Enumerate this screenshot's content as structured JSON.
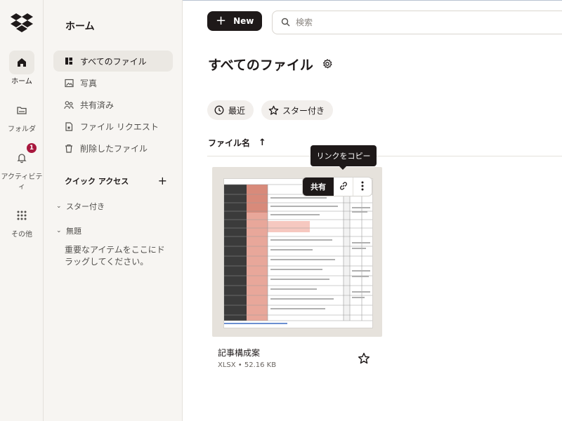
{
  "rail": {
    "items": [
      {
        "label": "ホーム",
        "icon": "home-icon"
      },
      {
        "label": "フォルダ",
        "icon": "folder-icon"
      },
      {
        "label": "アクティビティ",
        "icon": "bell-icon",
        "badge": "1"
      },
      {
        "label": "その他",
        "icon": "grid-icon"
      }
    ]
  },
  "sidebar": {
    "title": "ホーム",
    "items": [
      {
        "label": "すべてのファイル",
        "icon": "all-files-icon"
      },
      {
        "label": "写真",
        "icon": "photo-icon"
      },
      {
        "label": "共有済み",
        "icon": "shared-icon"
      },
      {
        "label": "ファイル リクエスト",
        "icon": "file-request-icon"
      },
      {
        "label": "削除したファイル",
        "icon": "trash-icon"
      }
    ],
    "quick_access": {
      "heading": "クイック アクセス",
      "add": "+",
      "groups": [
        {
          "label": "スター付き"
        },
        {
          "label": "無題"
        }
      ],
      "drag_hint": "重要なアイテムをここにドラッグしてください。"
    }
  },
  "toolbar": {
    "new_label": "New",
    "search_placeholder": "検索"
  },
  "main": {
    "title": "すべてのファイル",
    "chips": [
      {
        "label": "最近",
        "icon": "clock-icon"
      },
      {
        "label": "スター付き",
        "icon": "star-icon"
      }
    ],
    "column_header": "ファイル名",
    "sort_arrow": "↑"
  },
  "file_card": {
    "tooltip": "リンクをコピー",
    "share_label": "共有",
    "name": "記事構成案",
    "meta": "XLSX • 52.16 KB"
  },
  "colors": {
    "accent_dark": "#1e1919",
    "sidebar_bg": "#f7f5f2",
    "badge": "#a8183e"
  }
}
